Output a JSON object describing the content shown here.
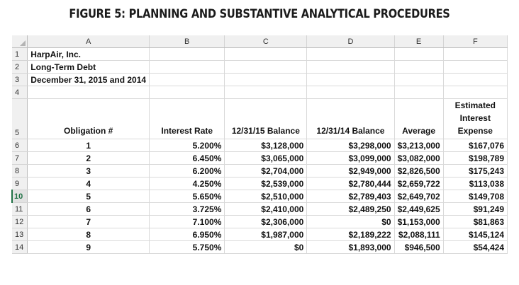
{
  "figure_title": "FIGURE 5: PLANNING AND SUBSTANTIVE ANALYTICAL PROCEDURES",
  "columns": [
    "A",
    "B",
    "C",
    "D",
    "E",
    "F"
  ],
  "row_numbers": [
    "1",
    "2",
    "3",
    "4",
    "5",
    "6",
    "7",
    "8",
    "9",
    "10",
    "11",
    "12",
    "13",
    "14"
  ],
  "title_rows": [
    "HarpAir, Inc.",
    "Long-Term Debt",
    "December 31, 2015 and 2014"
  ],
  "headers": [
    "Obligation #",
    "Interest Rate",
    "12/31/15 Balance",
    "12/31/14 Balance",
    "Average",
    "Estimated Interest Expense"
  ],
  "rows": [
    [
      "1",
      "5.200%",
      "$3,128,000",
      "$3,298,000",
      "$3,213,000",
      "$167,076"
    ],
    [
      "2",
      "6.450%",
      "$3,065,000",
      "$3,099,000",
      "$3,082,000",
      "$198,789"
    ],
    [
      "3",
      "6.200%",
      "$2,704,000",
      "$2,949,000",
      "$2,826,500",
      "$175,243"
    ],
    [
      "4",
      "4.250%",
      "$2,539,000",
      "$2,780,444",
      "$2,659,722",
      "$113,038"
    ],
    [
      "5",
      "5.650%",
      "$2,510,000",
      "$2,789,403",
      "$2,649,702",
      "$149,708"
    ],
    [
      "6",
      "3.725%",
      "$2,410,000",
      "$2,489,250",
      "$2,449,625",
      "$91,249"
    ],
    [
      "7",
      "7.100%",
      "$2,306,000",
      "$0",
      "$1,153,000",
      "$81,863"
    ],
    [
      "8",
      "6.950%",
      "$1,987,000",
      "$2,189,222",
      "$2,088,111",
      "$145,124"
    ],
    [
      "9",
      "5.750%",
      "$0",
      "$1,893,000",
      "$946,500",
      "$54,424"
    ]
  ],
  "selected_row": "10",
  "colors": {
    "selection_accent": "#217346",
    "header_bg": "#f0f0f0"
  }
}
